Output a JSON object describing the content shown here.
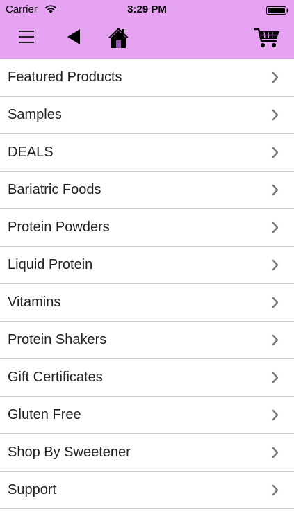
{
  "status_bar": {
    "carrier": "Carrier",
    "time": "3:29 PM",
    "wifi_icon": "wifi-icon",
    "battery_icon": "battery-icon"
  },
  "nav_bar": {
    "background_color": "#e5a3f2",
    "menu_icon": "hamburger-menu-icon",
    "back_icon": "back-arrow-icon",
    "home_icon": "home-icon",
    "cart_icon": "shopping-cart-icon"
  },
  "menu": {
    "items": [
      {
        "label": "Featured Products"
      },
      {
        "label": "Samples"
      },
      {
        "label": "DEALS"
      },
      {
        "label": "Bariatric Foods"
      },
      {
        "label": "Protein Powders"
      },
      {
        "label": "Liquid Protein"
      },
      {
        "label": "Vitamins"
      },
      {
        "label": "Protein Shakers"
      },
      {
        "label": "Gift Certificates"
      },
      {
        "label": "Gluten Free"
      },
      {
        "label": "Shop By Sweetener"
      },
      {
        "label": "Support"
      }
    ],
    "chevron_icon": "chevron-right-icon"
  }
}
